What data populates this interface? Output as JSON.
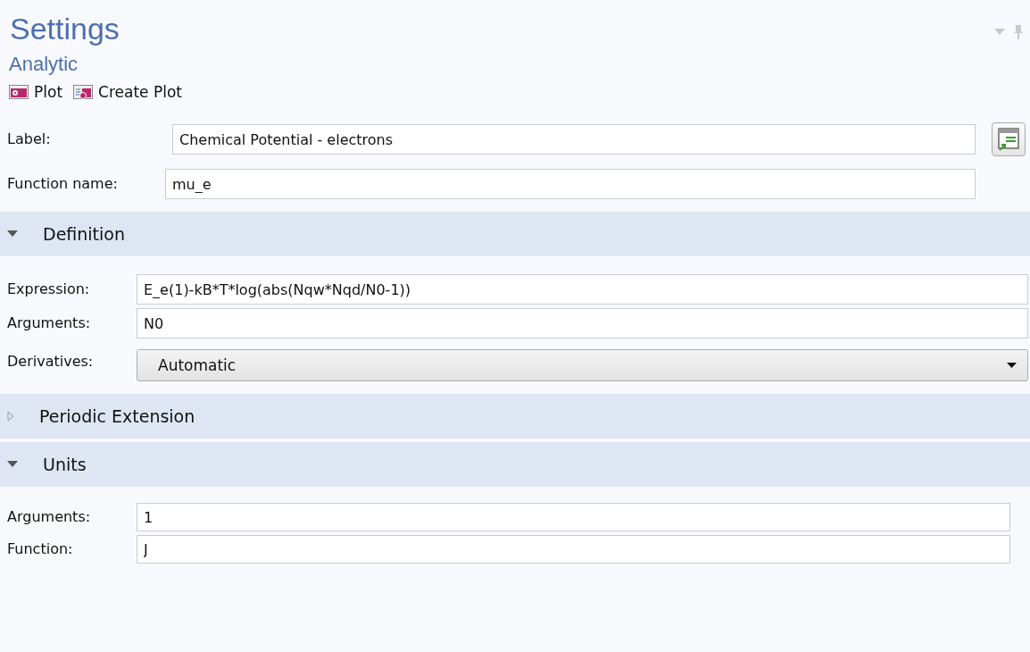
{
  "title": "Settings",
  "subtitle": "Analytic",
  "toolbar": [
    {
      "label": "Plot",
      "kind": "plot"
    },
    {
      "label": "Create Plot",
      "kind": "create"
    }
  ],
  "top_fields": [
    {
      "label": "Label:",
      "value": "Chemical Potential - electrons",
      "kind": "text-button"
    },
    {
      "label": "Function name:",
      "value": "mu_e",
      "kind": "text"
    }
  ],
  "sections": [
    {
      "title": "Definition",
      "expanded": true,
      "fields": [
        {
          "kind": "text",
          "label": "Expression:",
          "value": "E_e(1)-kB*T*log(abs(Nqw*Nqd/N0-1))"
        },
        {
          "kind": "text",
          "label": "Arguments:",
          "value": "N0"
        },
        {
          "kind": "select",
          "label": "Derivatives:",
          "value": "Automatic"
        }
      ]
    },
    {
      "title": "Periodic Extension",
      "expanded": false
    },
    {
      "title": "Units",
      "expanded": true,
      "fields": [
        {
          "kind": "text",
          "label": "Arguments:",
          "value": "1"
        },
        {
          "kind": "text",
          "label": "Function:",
          "value": "J"
        }
      ]
    }
  ]
}
